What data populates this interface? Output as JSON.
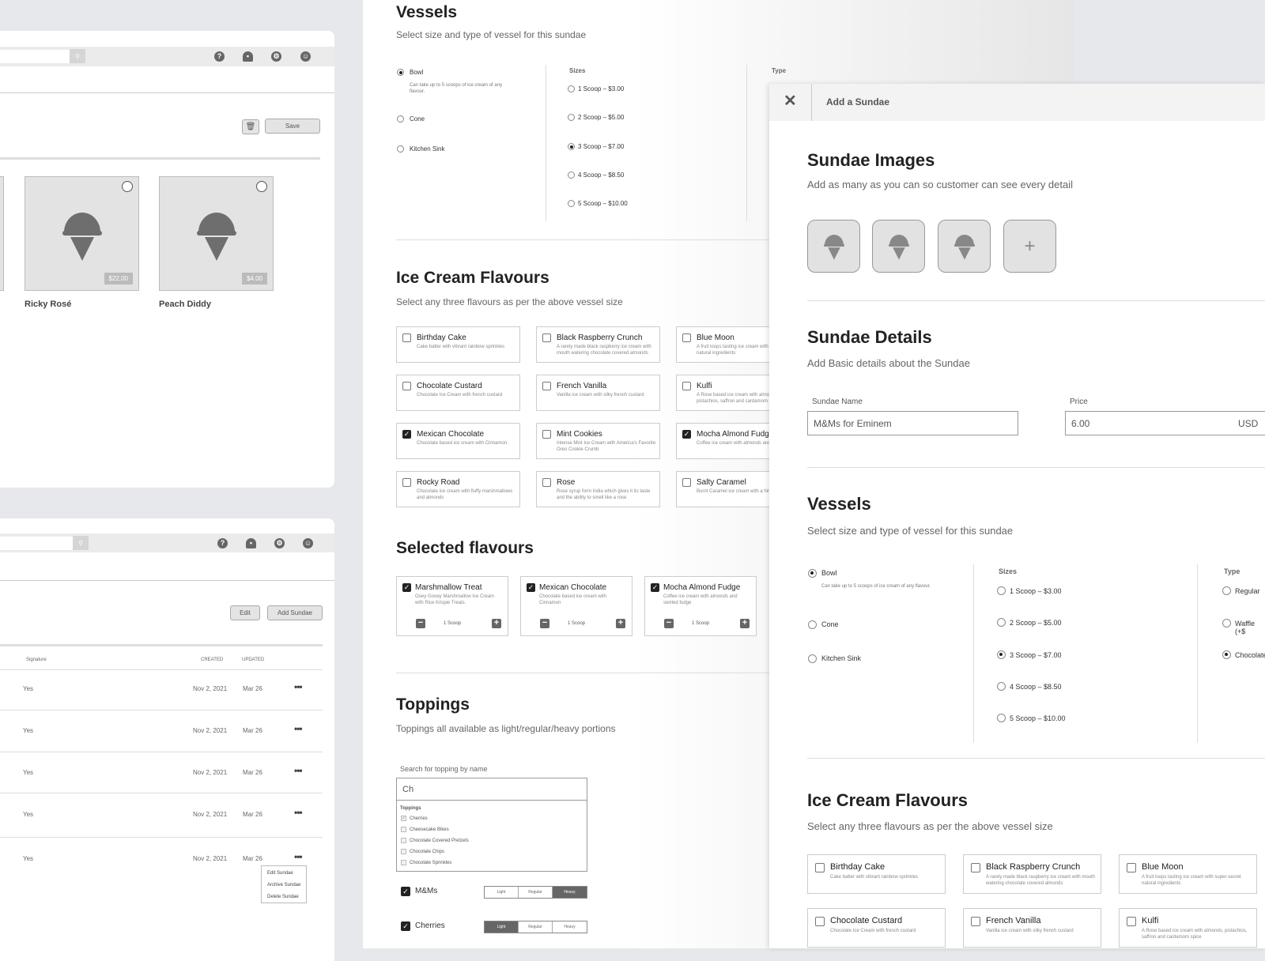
{
  "top_list": {
    "save": "Save",
    "cards": [
      {
        "name": "Ricky Rosé",
        "price": "$22.00"
      },
      {
        "name": "Peach Diddy",
        "price": "$4.00"
      }
    ]
  },
  "table": {
    "edit": "Edit",
    "add": "Add Sundae",
    "headers": {
      "signature": "Signature",
      "created": "CREATED",
      "updated": "UPDATED"
    },
    "rows": [
      {
        "signature": "Yes",
        "created": "Nov 2, 2021",
        "updated": "Mar 26"
      },
      {
        "signature": "Yes",
        "created": "Nov 2, 2021",
        "updated": "Mar 26"
      },
      {
        "signature": "Yes",
        "created": "Nov 2, 2021",
        "updated": "Mar 26"
      },
      {
        "signature": "Yes",
        "created": "Nov 2, 2021",
        "updated": "Mar 26"
      },
      {
        "signature": "Yes",
        "created": "Nov 2, 2021",
        "updated": "Mar 26"
      }
    ],
    "menu": [
      "Edit Sundae",
      "Archive Sundae",
      "Delete Sundae"
    ]
  },
  "middle": {
    "vessels_title": "Vessels",
    "vessels_sub": "Select size and type of vessel for this sundae",
    "vessels": [
      {
        "label": "Bowl",
        "desc": "Can take up to 5 scoops of ice cream of any flavour.",
        "on": true
      },
      {
        "label": "Cone",
        "on": false
      },
      {
        "label": "Kitchen Sink",
        "on": false
      }
    ],
    "sizes_label": "Sizes",
    "sizes": [
      "1 Scoop – $3.00",
      "2 Scoop – $5.00",
      "3 Scoop – $7.00",
      "4 Scoop – $8.50",
      "5 Scoop – $10.00"
    ],
    "selected_size": 2,
    "type_label": "Type",
    "flavours_title": "Ice Cream Flavours",
    "flavours_sub": "Select any three flavours as per the above vessel size",
    "flavours": [
      {
        "name": "Birthday Cake",
        "desc": "Cake batter with vibrant rainbow sprinkles",
        "on": false
      },
      {
        "name": "Black Raspberry Crunch",
        "desc": "A rarely made black raspberry ice cream with mouth watering chocolate covered almonds",
        "on": false
      },
      {
        "name": "Blue Moon",
        "desc": "A fruit loops tasting ice cream with secret natural ingredients",
        "on": false
      },
      {
        "name": "Chocolate Custard",
        "desc": "Chocolate Ice Cream with french custard",
        "on": false
      },
      {
        "name": "French Vanilla",
        "desc": "Vanilla ice cream with silky french custard",
        "on": false
      },
      {
        "name": "Kulfi",
        "desc": "A Rose based ice cream with almonds, pistachios, saffron and cardamom",
        "on": false
      },
      {
        "name": "Mexican Chocolate",
        "desc": "Chocolate based ice cream with Cinnamon",
        "on": true
      },
      {
        "name": "Mint Cookies",
        "desc": "Intense Mint Ice Cream with America's Favorite Oreo Cookie Crumb",
        "on": false
      },
      {
        "name": "Mocha Almond Fudge",
        "desc": "Coffee ice cream with almonds and fudge",
        "on": true
      },
      {
        "name": "Rocky Road",
        "desc": "Chocolate ice cream with fluffy marshmallows and almonds",
        "on": false
      },
      {
        "name": "Rose",
        "desc": "Rose syrup form India which gives it its taste and the ability to smell like a rose",
        "on": false
      },
      {
        "name": "Salty Caramel",
        "desc": "Burnt Caramel ice cream with a hint of sea salt",
        "on": false
      }
    ],
    "selected_title": "Selected flavours",
    "selected": [
      {
        "name": "Marshmallow Treat",
        "desc": "Ooey Gooey Marshmallow Ice Cream with Rice Krispie Treats.",
        "qty": "1 Scoop"
      },
      {
        "name": "Mexican Chocolate",
        "desc": "Chocolate based ice cream with Cinnamon",
        "qty": "1 Scoop"
      },
      {
        "name": "Mocha Almond Fudge",
        "desc": "Coffee ice cream with almonds and swirled fudge",
        "qty": "1 Scoop"
      }
    ],
    "toppings_title": "Toppings",
    "toppings_sub": "Toppings all available as light/regular/heavy portions",
    "search_label": "Search for topping by name",
    "search_value": "Ch",
    "dropdown_header": "Toppings",
    "dropdown": [
      {
        "name": "Cherries",
        "on": true
      },
      {
        "name": "Cheesecake Bikes",
        "on": false
      },
      {
        "name": "Chocolate Covered Pretzels",
        "on": false
      },
      {
        "name": "Chocolate Chips",
        "on": false
      },
      {
        "name": "Chocolate Sprinkles",
        "on": false
      }
    ],
    "portions": [
      "Light",
      "Regular",
      "Heavy"
    ],
    "chosen": [
      {
        "name": "M&Ms",
        "portion": 2
      },
      {
        "name": "Cherries",
        "portion": 0
      }
    ]
  },
  "right": {
    "header": "Add a Sundae",
    "images_title": "Sundae Images",
    "images_sub": "Add as many as you can so customer can see every detail",
    "details_title": "Sundae Details",
    "details_sub": "Add Basic details about the Sundae",
    "name_label": "Sundae Name",
    "name_value": "M&Ms for Eminem",
    "price_label": "Price",
    "price_value": "6.00",
    "currency": "USD",
    "vessels_title": "Vessels",
    "vessels_sub": "Select size and type of vessel for this sundae",
    "sizes_label": "Sizes",
    "type_label": "Type",
    "types": [
      {
        "label": "Regular",
        "on": false
      },
      {
        "label": "Waffle (+$",
        "on": false
      },
      {
        "label": "Chocolate",
        "on": true
      }
    ],
    "flavours_title": "Ice Cream Flavours",
    "flavours_sub": "Select any three flavours as per the above vessel size",
    "flavours": [
      {
        "name": "Birthday Cake",
        "desc": "Cake batter with vibrant rainbow sprinkles"
      },
      {
        "name": "Black Raspberry Crunch",
        "desc": "A rarely made black raspberry ice cream with mouth watering chocolate covered almonds"
      },
      {
        "name": "Blue Moon",
        "desc": "A fruit loops tasting ice cream with super-secret natural ingredients"
      },
      {
        "name": "Chocolate Custard",
        "desc": "Chocolate Ice Cream with french custard"
      },
      {
        "name": "French Vanilla",
        "desc": "Vanilla ice cream with silky french custard"
      },
      {
        "name": "Kulfi",
        "desc": "A Rose based ice cream with almonds, pistachios, saffron and cardamom spice"
      }
    ]
  }
}
